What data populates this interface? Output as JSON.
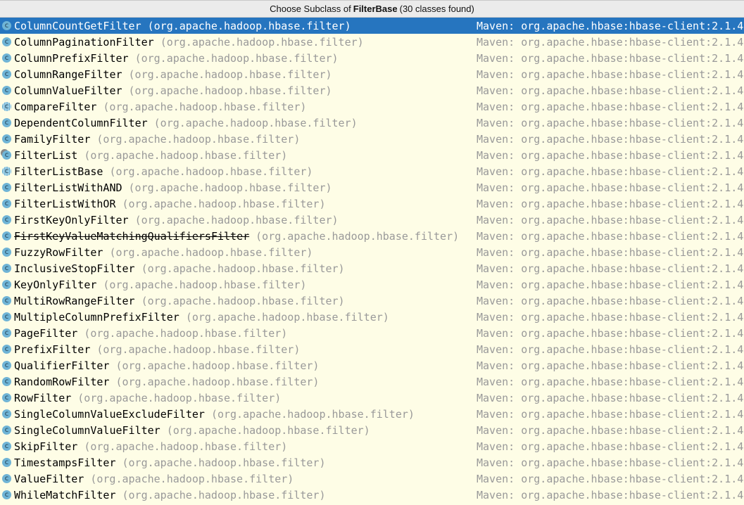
{
  "header": {
    "prefix": "Choose Subclass of",
    "base": "FilterBase",
    "suffix": "(30 classes found)"
  },
  "selected_index": 0,
  "items": [
    {
      "name": "ColumnCountGetFilter",
      "pkg": "(org.apache.hadoop.hbase.filter)",
      "source": "Maven: org.apache.hbase:hbase-client:2.1.4",
      "icon": "class-icon"
    },
    {
      "name": "ColumnPaginationFilter",
      "pkg": "(org.apache.hadoop.hbase.filter)",
      "source": "Maven: org.apache.hbase:hbase-client:2.1.4",
      "icon": "class-icon"
    },
    {
      "name": "ColumnPrefixFilter",
      "pkg": "(org.apache.hadoop.hbase.filter)",
      "source": "Maven: org.apache.hbase:hbase-client:2.1.4",
      "icon": "class-icon"
    },
    {
      "name": "ColumnRangeFilter",
      "pkg": "(org.apache.hadoop.hbase.filter)",
      "source": "Maven: org.apache.hbase:hbase-client:2.1.4",
      "icon": "class-icon"
    },
    {
      "name": "ColumnValueFilter",
      "pkg": "(org.apache.hadoop.hbase.filter)",
      "source": "Maven: org.apache.hbase:hbase-client:2.1.4",
      "icon": "class-icon"
    },
    {
      "name": "CompareFilter",
      "pkg": "(org.apache.hadoop.hbase.filter)",
      "source": "Maven: org.apache.hbase:hbase-client:2.1.4",
      "icon": "abstract-class-icon"
    },
    {
      "name": "DependentColumnFilter",
      "pkg": "(org.apache.hadoop.hbase.filter)",
      "source": "Maven: org.apache.hbase:hbase-client:2.1.4",
      "icon": "class-icon"
    },
    {
      "name": "FamilyFilter",
      "pkg": "(org.apache.hadoop.hbase.filter)",
      "source": "Maven: org.apache.hbase:hbase-client:2.1.4",
      "icon": "class-icon"
    },
    {
      "name": "FilterList",
      "pkg": "(org.apache.hadoop.hbase.filter)",
      "source": "Maven: org.apache.hbase:hbase-client:2.1.4",
      "icon": "final-class-icon"
    },
    {
      "name": "FilterListBase",
      "pkg": "(org.apache.hadoop.hbase.filter)",
      "source": "Maven: org.apache.hbase:hbase-client:2.1.4",
      "icon": "abstract-class-icon"
    },
    {
      "name": "FilterListWithAND",
      "pkg": "(org.apache.hadoop.hbase.filter)",
      "source": "Maven: org.apache.hbase:hbase-client:2.1.4",
      "icon": "class-icon"
    },
    {
      "name": "FilterListWithOR",
      "pkg": "(org.apache.hadoop.hbase.filter)",
      "source": "Maven: org.apache.hbase:hbase-client:2.1.4",
      "icon": "class-icon"
    },
    {
      "name": "FirstKeyOnlyFilter",
      "pkg": "(org.apache.hadoop.hbase.filter)",
      "source": "Maven: org.apache.hbase:hbase-client:2.1.4",
      "icon": "class-icon"
    },
    {
      "name": "FirstKeyValueMatchingQualifiersFilter",
      "pkg": "(org.apache.hadoop.hbase.filter)",
      "source": "Maven: org.apache.hbase:hbase-client:2.1.4",
      "icon": "class-icon",
      "deprecated": true
    },
    {
      "name": "FuzzyRowFilter",
      "pkg": "(org.apache.hadoop.hbase.filter)",
      "source": "Maven: org.apache.hbase:hbase-client:2.1.4",
      "icon": "class-icon"
    },
    {
      "name": "InclusiveStopFilter",
      "pkg": "(org.apache.hadoop.hbase.filter)",
      "source": "Maven: org.apache.hbase:hbase-client:2.1.4",
      "icon": "class-icon"
    },
    {
      "name": "KeyOnlyFilter",
      "pkg": "(org.apache.hadoop.hbase.filter)",
      "source": "Maven: org.apache.hbase:hbase-client:2.1.4",
      "icon": "class-icon"
    },
    {
      "name": "MultiRowRangeFilter",
      "pkg": "(org.apache.hadoop.hbase.filter)",
      "source": "Maven: org.apache.hbase:hbase-client:2.1.4",
      "icon": "class-icon"
    },
    {
      "name": "MultipleColumnPrefixFilter",
      "pkg": "(org.apache.hadoop.hbase.filter)",
      "source": "Maven: org.apache.hbase:hbase-client:2.1.4",
      "icon": "class-icon"
    },
    {
      "name": "PageFilter",
      "pkg": "(org.apache.hadoop.hbase.filter)",
      "source": "Maven: org.apache.hbase:hbase-client:2.1.4",
      "icon": "class-icon"
    },
    {
      "name": "PrefixFilter",
      "pkg": "(org.apache.hadoop.hbase.filter)",
      "source": "Maven: org.apache.hbase:hbase-client:2.1.4",
      "icon": "class-icon"
    },
    {
      "name": "QualifierFilter",
      "pkg": "(org.apache.hadoop.hbase.filter)",
      "source": "Maven: org.apache.hbase:hbase-client:2.1.4",
      "icon": "class-icon"
    },
    {
      "name": "RandomRowFilter",
      "pkg": "(org.apache.hadoop.hbase.filter)",
      "source": "Maven: org.apache.hbase:hbase-client:2.1.4",
      "icon": "class-icon"
    },
    {
      "name": "RowFilter",
      "pkg": "(org.apache.hadoop.hbase.filter)",
      "source": "Maven: org.apache.hbase:hbase-client:2.1.4",
      "icon": "class-icon"
    },
    {
      "name": "SingleColumnValueExcludeFilter",
      "pkg": "(org.apache.hadoop.hbase.filter)",
      "source": "Maven: org.apache.hbase:hbase-client:2.1.4",
      "icon": "class-icon"
    },
    {
      "name": "SingleColumnValueFilter",
      "pkg": "(org.apache.hadoop.hbase.filter)",
      "source": "Maven: org.apache.hbase:hbase-client:2.1.4",
      "icon": "class-icon"
    },
    {
      "name": "SkipFilter",
      "pkg": "(org.apache.hadoop.hbase.filter)",
      "source": "Maven: org.apache.hbase:hbase-client:2.1.4",
      "icon": "class-icon"
    },
    {
      "name": "TimestampsFilter",
      "pkg": "(org.apache.hadoop.hbase.filter)",
      "source": "Maven: org.apache.hbase:hbase-client:2.1.4",
      "icon": "class-icon"
    },
    {
      "name": "ValueFilter",
      "pkg": "(org.apache.hadoop.hbase.filter)",
      "source": "Maven: org.apache.hbase:hbase-client:2.1.4",
      "icon": "class-icon"
    },
    {
      "name": "WhileMatchFilter",
      "pkg": "(org.apache.hadoop.hbase.filter)",
      "source": "Maven: org.apache.hbase:hbase-client:2.1.4",
      "icon": "class-icon"
    }
  ],
  "colors": {
    "selection": "#2675bf",
    "background": "#fefde6",
    "icon": "#6fb4d6",
    "secondary_text": "#999999"
  }
}
